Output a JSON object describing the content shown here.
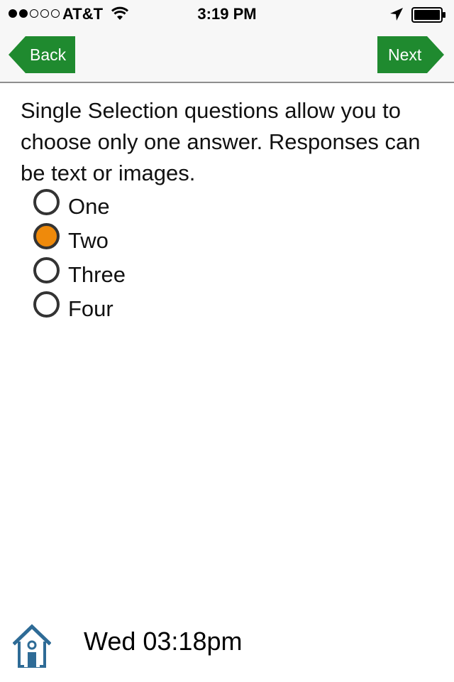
{
  "status_bar": {
    "carrier": "AT&T",
    "time": "3:19 PM",
    "signal_bars_filled": 2,
    "signal_bars_total": 5,
    "icons": [
      "wifi-icon",
      "location-arrow-icon",
      "battery-icon"
    ]
  },
  "nav": {
    "back_label": "Back",
    "next_label": "Next",
    "button_color": "#1f8a2f"
  },
  "question": {
    "text": "Single Selection questions allow you to choose only one answer. Responses can be text or images."
  },
  "options": [
    {
      "label": "One",
      "selected": false
    },
    {
      "label": "Two",
      "selected": true
    },
    {
      "label": "Three",
      "selected": false
    },
    {
      "label": "Four",
      "selected": false
    }
  ],
  "footer": {
    "timestamp": "Wed 03:18pm",
    "home_icon": "home-icon",
    "home_icon_color": "#2e6b96"
  },
  "colors": {
    "selected_radio": "#ef8a0b"
  }
}
